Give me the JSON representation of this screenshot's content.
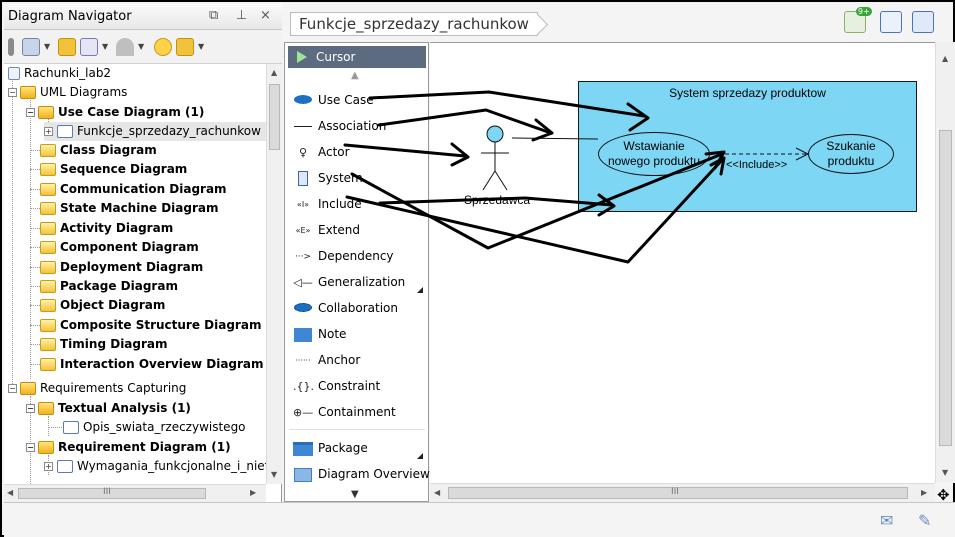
{
  "navigator": {
    "title": "Diagram Navigator",
    "controls": [
      "⧉",
      "⊥",
      "×"
    ],
    "scroll_thumb_symbol": "III",
    "tree": [
      {
        "label": "Rachunki_lab2",
        "bold": false
      },
      {
        "label": "UML Diagrams",
        "bold": false
      },
      {
        "label": "Use Case Diagram (1)",
        "bold": true
      },
      {
        "label": "Funkcje_sprzedazy_rachunkow",
        "bold": false
      },
      {
        "label": "Class Diagram",
        "bold": true
      },
      {
        "label": "Sequence Diagram",
        "bold": true
      },
      {
        "label": "Communication Diagram",
        "bold": true
      },
      {
        "label": "State Machine Diagram",
        "bold": true
      },
      {
        "label": "Activity Diagram",
        "bold": true
      },
      {
        "label": "Component Diagram",
        "bold": true
      },
      {
        "label": "Deployment Diagram",
        "bold": true
      },
      {
        "label": "Package Diagram",
        "bold": true
      },
      {
        "label": "Object Diagram",
        "bold": true
      },
      {
        "label": "Composite Structure Diagram",
        "bold": true
      },
      {
        "label": "Timing Diagram",
        "bold": true
      },
      {
        "label": "Interaction Overview Diagram",
        "bold": true
      },
      {
        "label": "Requirements Capturing",
        "bold": false
      },
      {
        "label": "Textual Analysis (1)",
        "bold": true
      },
      {
        "label": "Opis_swiata_rzeczywistego",
        "bold": false
      },
      {
        "label": "Requirement Diagram (1)",
        "bold": true
      },
      {
        "label": "Wymagania_funkcjonalne_i_niefu",
        "bold": false
      }
    ]
  },
  "breadcrumb": "Funkcje_sprzedazy_rachunkow",
  "toolbar_badge": "9+",
  "palette": {
    "cursor": "Cursor",
    "items": [
      {
        "label": "Use Case",
        "icon": "use-case-icon",
        "glyph": "⬬"
      },
      {
        "label": "Association",
        "icon": "association-icon",
        "glyph": "—"
      },
      {
        "label": "Actor",
        "icon": "actor-icon",
        "glyph": "♀"
      },
      {
        "label": "System",
        "icon": "system-icon",
        "glyph": "▯"
      },
      {
        "label": "Include",
        "icon": "include-icon",
        "glyph": "«I»"
      },
      {
        "label": "Extend",
        "icon": "extend-icon",
        "glyph": "«E»"
      },
      {
        "label": "Dependency",
        "icon": "dependency-icon",
        "glyph": "···>"
      },
      {
        "label": "Generalization",
        "icon": "generalization-icon",
        "glyph": "◁—"
      },
      {
        "label": "Collaboration",
        "icon": "collaboration-icon",
        "glyph": "⬬"
      },
      {
        "label": "Note",
        "icon": "note-icon",
        "glyph": "▤"
      },
      {
        "label": "Anchor",
        "icon": "anchor-icon",
        "glyph": "······"
      },
      {
        "label": "Constraint",
        "icon": "constraint-icon",
        "glyph": ".{}."
      },
      {
        "label": "Containment",
        "icon": "containment-icon",
        "glyph": "⊕—"
      },
      {
        "label": "Package",
        "icon": "package-icon",
        "glyph": "▬"
      },
      {
        "label": "Diagram Overview",
        "icon": "diagram-overview-icon",
        "glyph": "▦"
      }
    ]
  },
  "diagram": {
    "system_title": "System sprzedazy produktow",
    "use_case_1": "Wstawianie\nnowego produktu",
    "use_case_2": "Szukanie\nproduktu",
    "include_label": "<<Include>>",
    "actor": "Sprzedawca"
  },
  "canvas_scroll_symbol": "III",
  "colors": {
    "system_fill": "#7ed6f5",
    "palette_cursor": "#5d6b80",
    "annotation": "#000000"
  }
}
